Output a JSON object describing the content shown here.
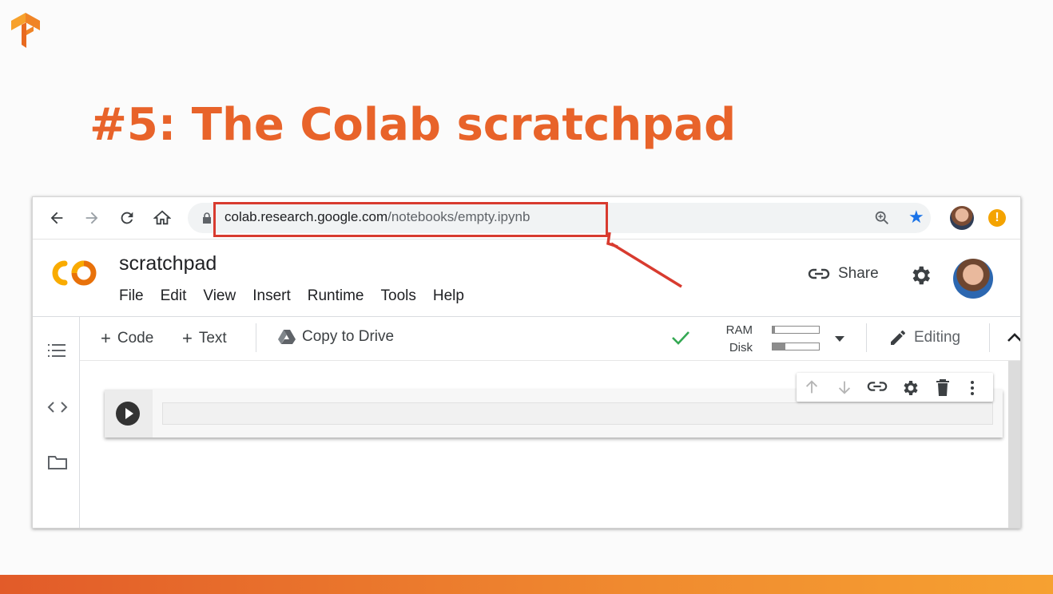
{
  "slide": {
    "title": "#5: The Colab scratchpad"
  },
  "browser": {
    "url_host": "colab.research.google.com",
    "url_path": "/notebooks/empty.ipynb"
  },
  "colab": {
    "notebook_title": "scratchpad",
    "menu": [
      "File",
      "Edit",
      "View",
      "Insert",
      "Runtime",
      "Tools",
      "Help"
    ],
    "share_label": "Share",
    "toolbar": {
      "code_label": "Code",
      "text_label": "Text",
      "copy_drive_label": "Copy to Drive",
      "ram_label": "RAM",
      "disk_label": "Disk",
      "ram_usage": 0.05,
      "disk_usage": 0.28,
      "editing_label": "Editing"
    }
  },
  "colors": {
    "title": "#e8632a",
    "highlight_box": "#d83b2f",
    "star": "#1a73e8",
    "connected_check": "#34a853"
  }
}
